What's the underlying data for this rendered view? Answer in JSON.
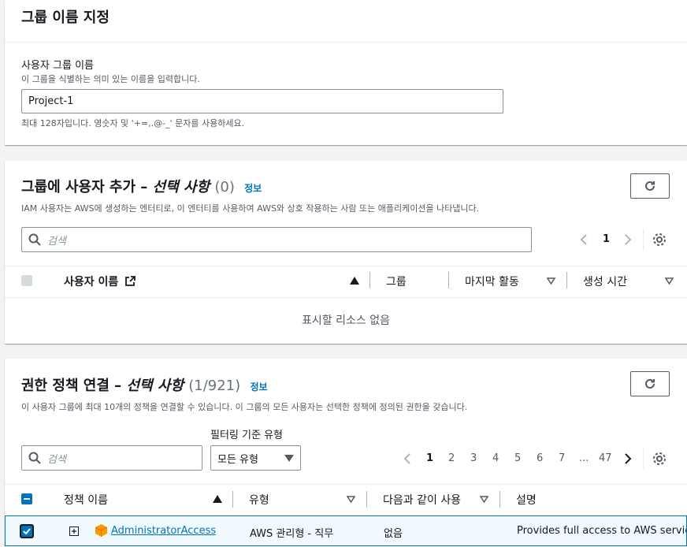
{
  "group_name_section": {
    "title": "그룹 이름 지정",
    "field_label": "사용자 그룹 이름",
    "field_desc": "이 그룹을 식별하는 의미 있는 이름을 입력합니다.",
    "field_value": "Project-1",
    "constraint": "최대 128자입니다. 영숫자 및 '+=,.@-_' 문자를 사용하세요."
  },
  "add_users_section": {
    "title_main": "그룹에 사용자 추가 – ",
    "title_optional": "선택 사항",
    "count": "(0)",
    "info_link": "정보",
    "desc": "IAM 사용자는 AWS에 생성하는 엔터티로, 이 엔터티를 사용하여 AWS와 상호 작용하는 사람 또는 애플리케이션을 나타냅니다.",
    "search_placeholder": "검색",
    "page": "1",
    "columns": {
      "username": "사용자 이름",
      "group": "그룹",
      "last_activity": "마지막 활동",
      "created": "생성 시간"
    },
    "empty_text": "표시할 리소스 없음"
  },
  "policies_section": {
    "title_main": "권한 정책 연결 – ",
    "title_optional": "선택 사항",
    "count": "(1/921)",
    "info_link": "정보",
    "desc": "이 사용자 그룹에 최대 10개의 정책을 연결할 수 있습니다. 이 그룹의 모든 사용자는 선택한 정책에 정의된 권한을 갖습니다.",
    "filter_label": "필터링 기준 유형",
    "filter_value": "모든 유형",
    "search_placeholder": "검색",
    "pages": [
      "1",
      "2",
      "3",
      "4",
      "5",
      "6",
      "7",
      "...",
      "47"
    ],
    "current_page": "1",
    "columns": {
      "policy_name": "정책 이름",
      "type": "유형",
      "used_as": "다음과 같이 사용",
      "description": "설명"
    },
    "rows": [
      {
        "name": "AdministratorAccess",
        "type": "AWS 관리형 - 직무",
        "used_as": "없음",
        "description": "Provides full access to AWS services and resources.",
        "checked": true
      }
    ]
  },
  "colors": {
    "accent": "#0073bb",
    "selected_row_bg": "#f1faff",
    "selected_row_border": "#0073bb",
    "aws_icon": "#ff9900"
  }
}
